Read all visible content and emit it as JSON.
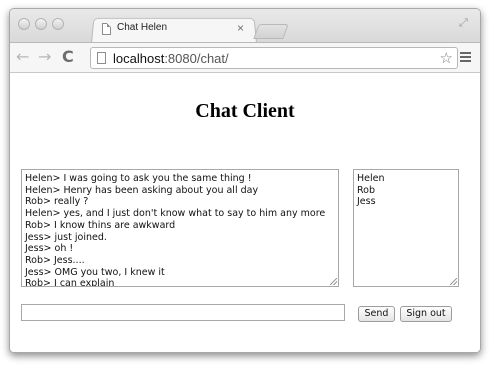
{
  "browser": {
    "tab_title": "Chat Helen",
    "tab_close": "×",
    "restore_glyph": "⤢",
    "url_host": "localhost",
    "url_rest": ":8080/chat/",
    "nav": {
      "back": "←",
      "forward": "→",
      "reload": "C",
      "bookmark_star": "☆"
    }
  },
  "page": {
    "heading": "Chat Client",
    "chat_cut_line": "Helen> I was going to ask you the same thing !",
    "chat_lines": [
      "Helen> I was going to ask you the same thing !",
      "Helen> Henry has been asking about you all day",
      "Rob> really ?",
      "Helen> yes, and I just don't know what to say to him any more",
      "Rob> I know thins are awkward",
      "Jess>  just joined.",
      "Jess> oh !",
      "Rob> Jess....",
      "Jess> OMG you two, I knew it",
      "Rob> I can explain"
    ],
    "users": [
      "Helen",
      "Rob",
      "Jess"
    ],
    "message_input_value": "",
    "send_label": "Send",
    "signout_label": "Sign out"
  }
}
